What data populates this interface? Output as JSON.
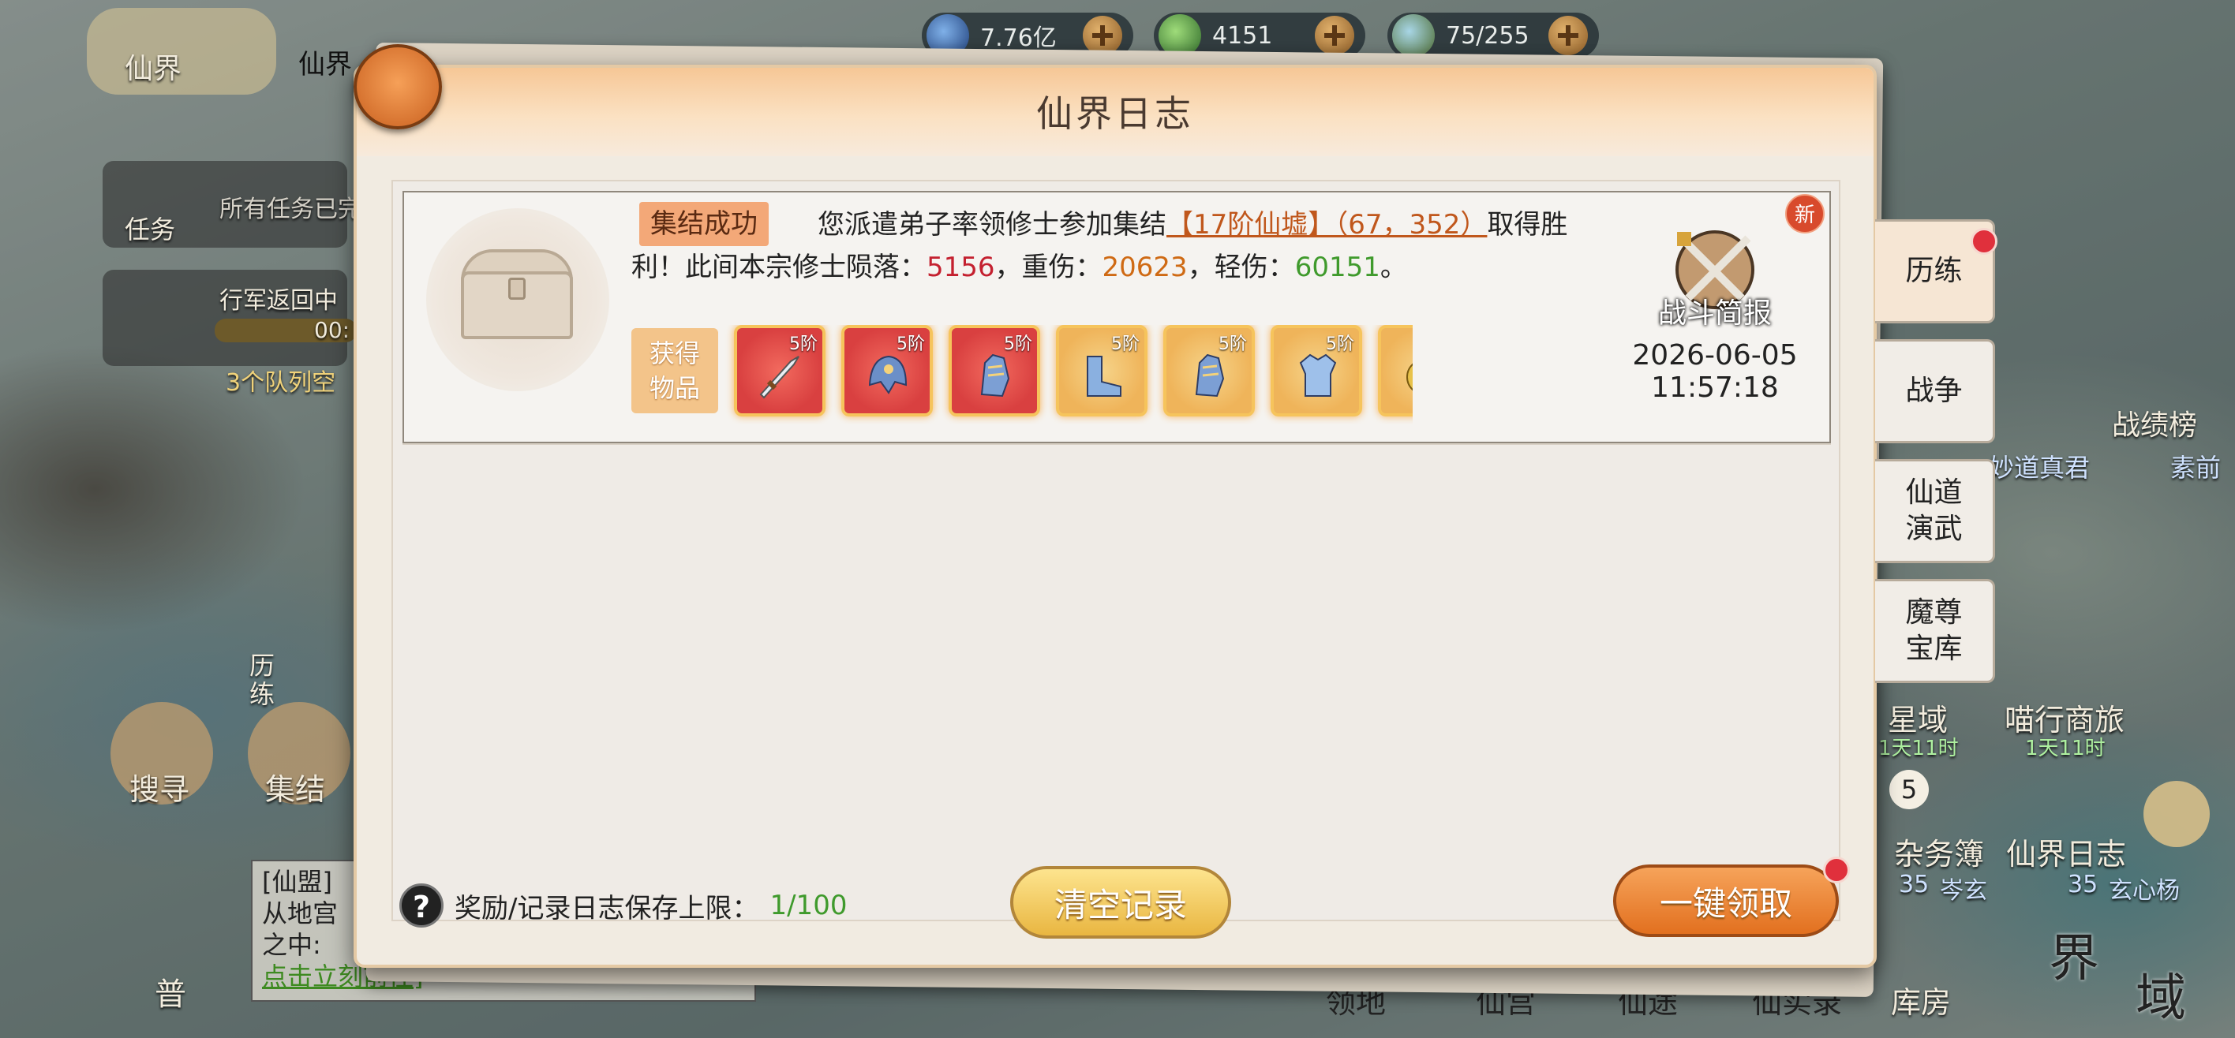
{
  "app": {
    "panel_title": "仙界日志"
  },
  "top_bar": {
    "resources": [
      {
        "icon": "spirit-stone-icon",
        "value": "7.76亿"
      },
      {
        "icon": "jade-icon",
        "value": "4151"
      },
      {
        "icon": "troop-icon",
        "value": "75/255"
      }
    ],
    "location_tabs": [
      "仙界",
      "仙界"
    ]
  },
  "left_hud": {
    "task_label": "任务",
    "task_text": "所有任务已完",
    "march_text": "行军返回中",
    "march_timer": "00:",
    "queue_text": "3个队列空",
    "training_label": "历练",
    "search_label": "搜寻",
    "gather_label": "集结",
    "alliance_chat": [
      "[仙盟]",
      "从地宫",
      "之中:"
    ],
    "alliance_link": "点击立刻前往]",
    "mode_badge": "普"
  },
  "right_hud": {
    "rank_label": "战绩榜",
    "names": [
      "妙道真君",
      "素前"
    ],
    "star_domain": "星域",
    "star_timer": "1天11时",
    "merchant": "喵行商旅",
    "merchant_timer": "1天11时",
    "chores": "杂务簿",
    "chores_count": "5",
    "journal": "仙界日志",
    "warehouse": "库房",
    "realm": [
      "界",
      "域"
    ],
    "bottom_tabs": [
      "领地",
      "仙宫",
      "仙途",
      "仙实录"
    ],
    "player_tags": [
      "35",
      "岑玄",
      "35",
      "玄心杨"
    ]
  },
  "entry": {
    "tag": "集结成功",
    "message_prefix": "您派遣弟子率领修士参加集结",
    "location": "【17阶仙墟】（67，352）",
    "message_mid": "取得胜利！此间本宗修士陨落：",
    "fallen": "5156",
    "sep1": "，重伤：",
    "heavy": "20623",
    "sep2": "，轻伤：",
    "light": "60151",
    "end": "。",
    "obtained_label": "获得物品",
    "items": [
      {
        "icon": "sword-icon",
        "level": "5阶"
      },
      {
        "icon": "helmet-icon",
        "level": "5阶"
      },
      {
        "icon": "gauntlet-icon",
        "level": "5阶"
      },
      {
        "icon": "boots-icon",
        "level": "5阶"
      },
      {
        "icon": "gauntlet-icon",
        "level": "5阶"
      },
      {
        "icon": "armor-icon",
        "level": "5阶"
      },
      {
        "icon": "item-icon",
        "level": ""
      }
    ],
    "report_label": "战斗简报",
    "date": "2026-06-05",
    "time": "11:57:18",
    "new_badge": "新"
  },
  "footer": {
    "limit_label": "奖励/记录日志保存上限：",
    "limit_value": "1/100",
    "clear_button": "清空记录",
    "claim_button": "一键领取"
  },
  "side_tabs": [
    {
      "label": "历练",
      "active": true
    },
    {
      "label": "战争",
      "active": false
    },
    {
      "label": "仙道演武",
      "active": false
    },
    {
      "label": "魔尊宝库",
      "active": false
    }
  ],
  "colors": {
    "fallen": "#c4202f",
    "heavy": "#cf6a14",
    "light": "#3f9a2c",
    "location": "#c0571c"
  }
}
